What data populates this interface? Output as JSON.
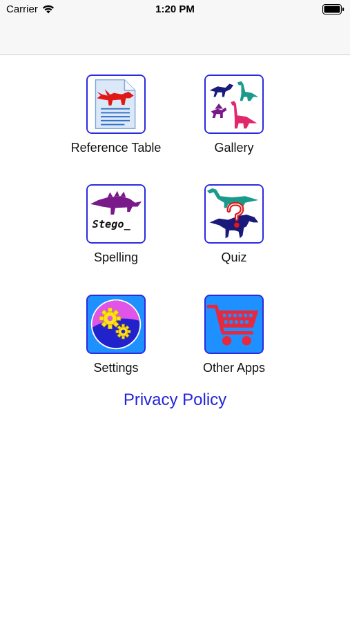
{
  "status_bar": {
    "carrier": "Carrier",
    "time": "1:20 PM"
  },
  "menu": {
    "reference_table": "Reference Table",
    "gallery": "Gallery",
    "spelling": "Spelling",
    "spelling_icon_text": "Stego_",
    "quiz": "Quiz",
    "settings": "Settings",
    "other_apps": "Other Apps"
  },
  "privacy_policy": "Privacy Policy",
  "colors": {
    "tile_border": "#2a2adf",
    "link": "#2424d8",
    "dino_red": "#e01818",
    "dino_purple": "#7a1a8a",
    "dino_teal": "#1a9a8a",
    "dino_pink": "#e0286a",
    "dino_navy": "#1a1a7a",
    "tile_blue_bg": "#1e90ff"
  }
}
